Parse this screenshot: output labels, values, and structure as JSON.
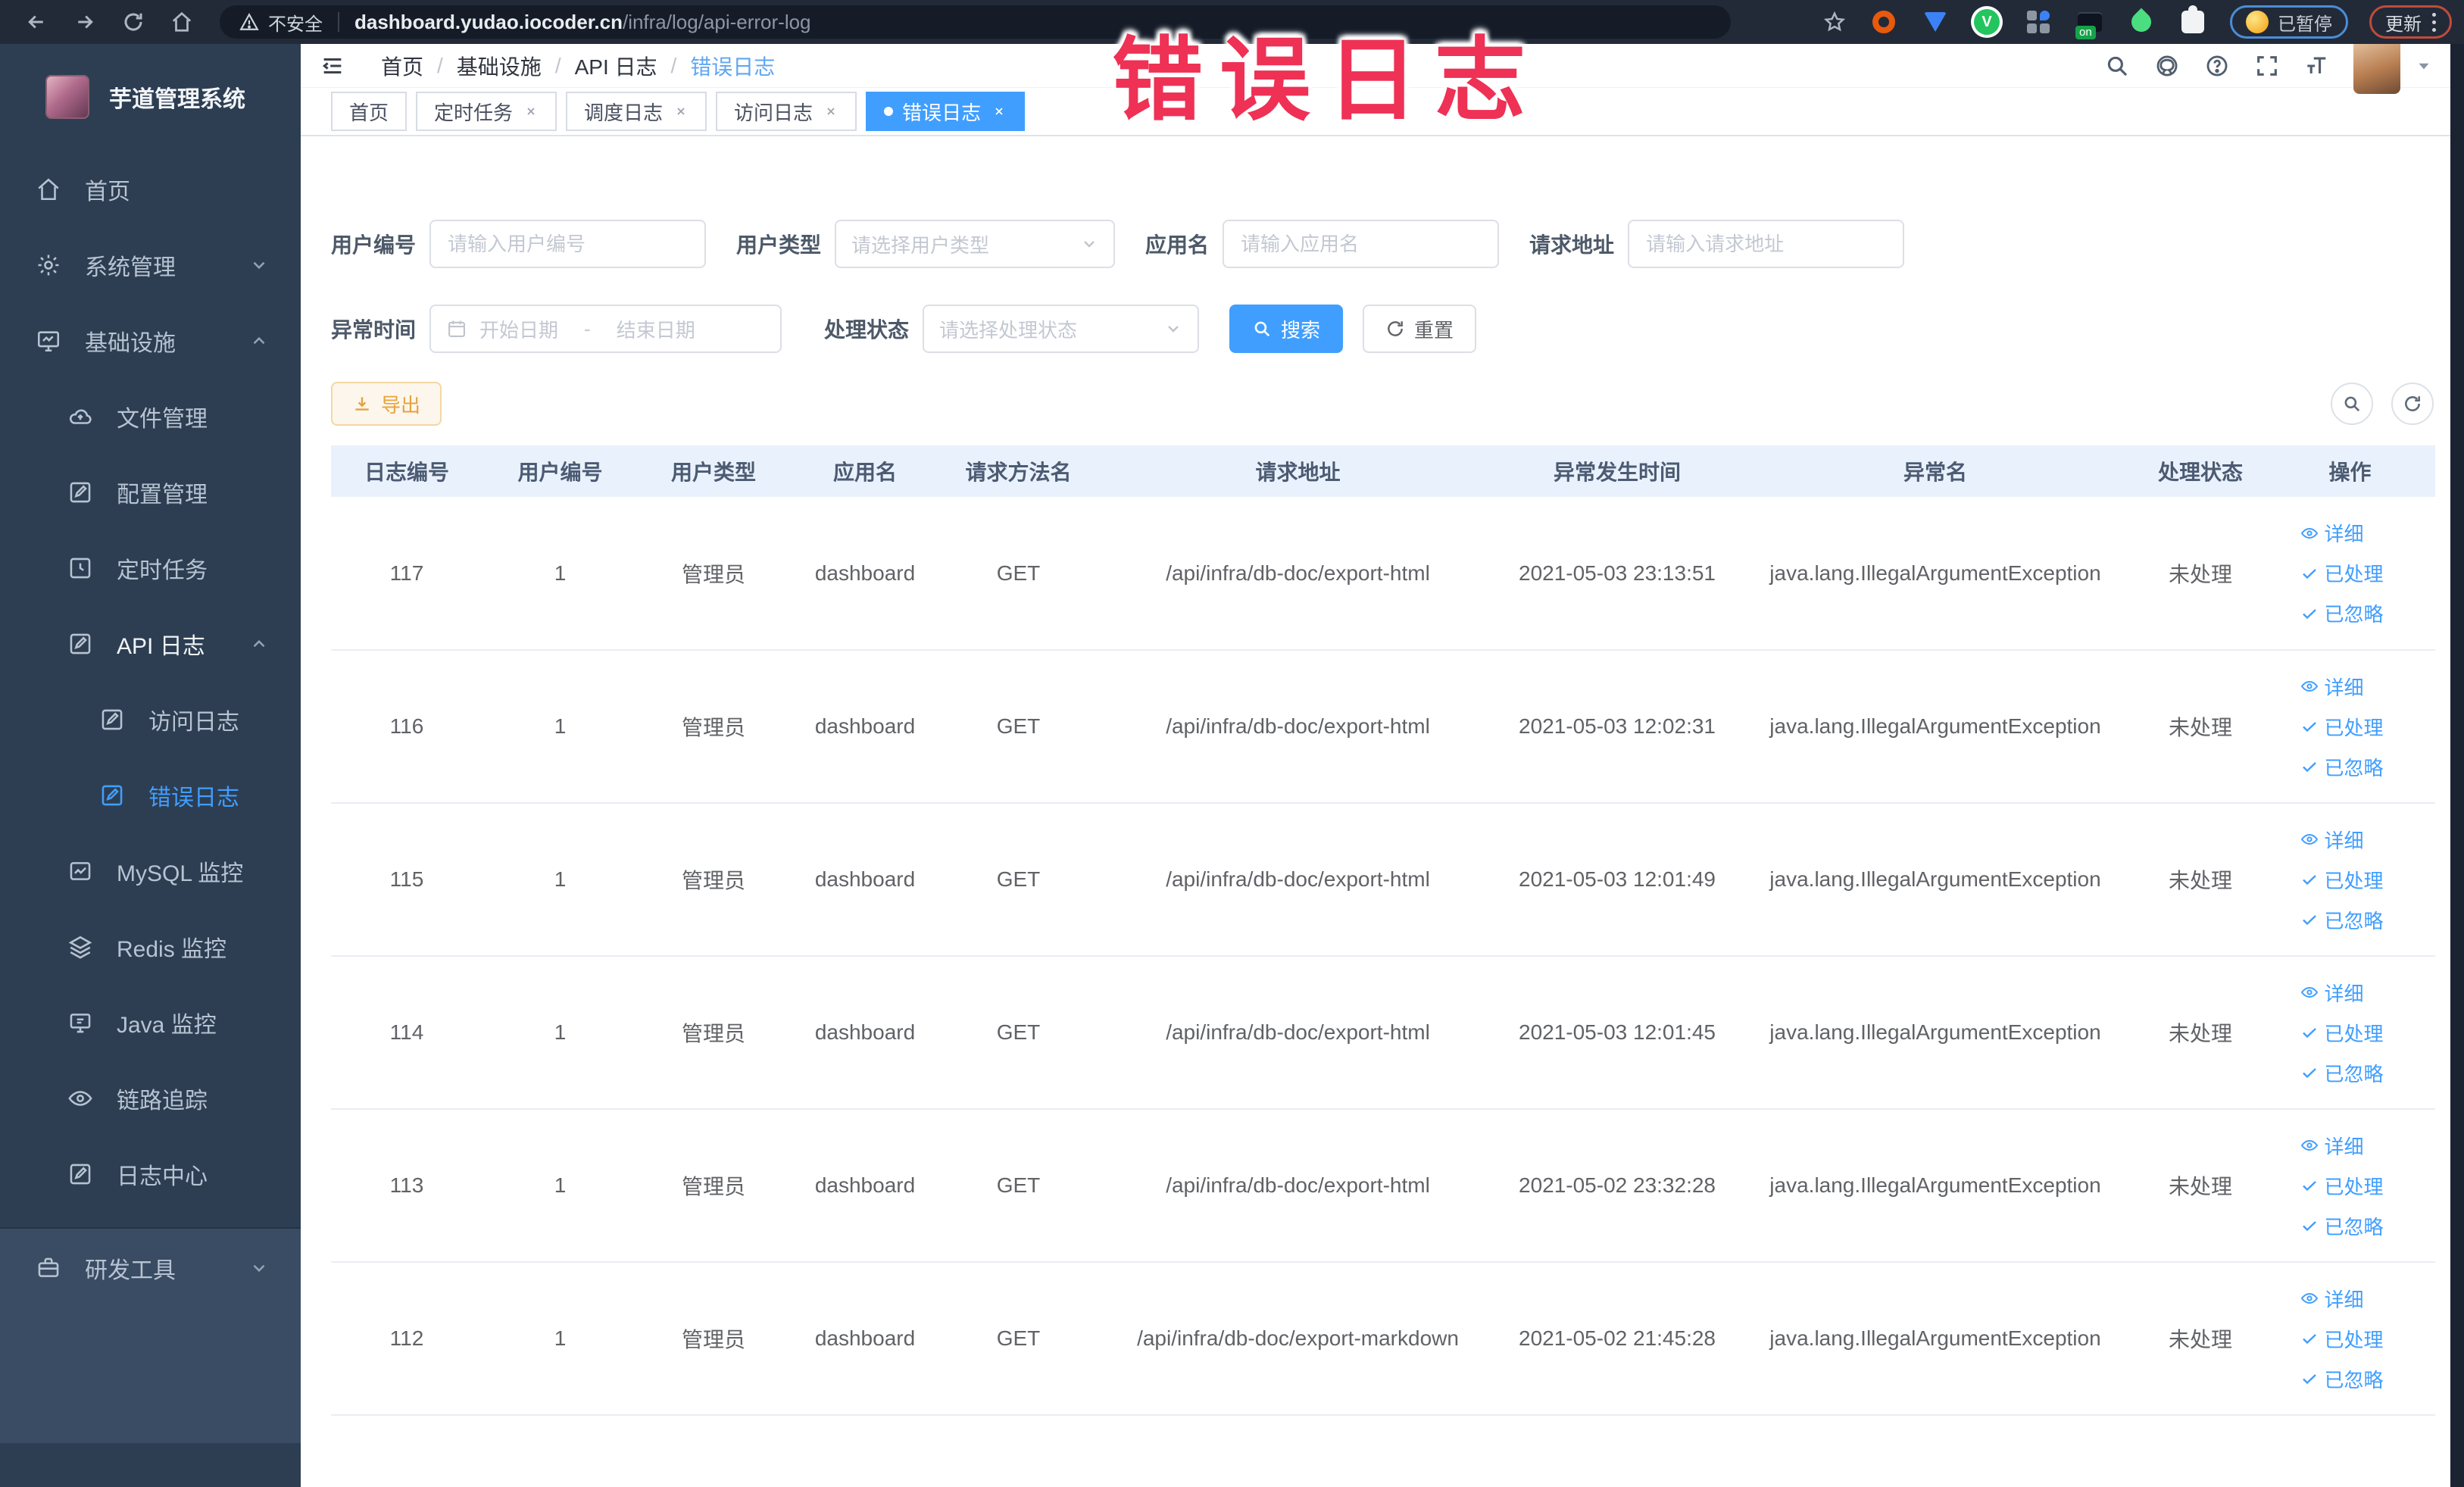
{
  "browser": {
    "security_label": "不安全",
    "url_host": "dashboard.yudao.iocoder.cn",
    "url_path": "/infra/log/api-error-log",
    "extension_badge_on": "on",
    "paused_pill": "已暂停",
    "update_pill": "更新"
  },
  "annotation": {
    "text": "错误日志",
    "color": "#ee3155"
  },
  "app": {
    "title": "芋道管理系统"
  },
  "sidebar": {
    "items": [
      {
        "label": "首页"
      },
      {
        "label": "系统管理"
      },
      {
        "label": "基础设施"
      },
      {
        "label": "文件管理"
      },
      {
        "label": "配置管理"
      },
      {
        "label": "定时任务"
      },
      {
        "label": "API 日志"
      },
      {
        "label": "访问日志"
      },
      {
        "label": "错误日志"
      },
      {
        "label": "MySQL 监控"
      },
      {
        "label": "Redis 监控"
      },
      {
        "label": "Java 监控"
      },
      {
        "label": "链路追踪"
      },
      {
        "label": "日志中心"
      },
      {
        "label": "研发工具"
      }
    ]
  },
  "breadcrumb": {
    "separator": "/",
    "items": [
      "首页",
      "基础设施",
      "API 日志",
      "错误日志"
    ]
  },
  "tabs": [
    {
      "label": "首页"
    },
    {
      "label": "定时任务"
    },
    {
      "label": "调度日志"
    },
    {
      "label": "访问日志"
    },
    {
      "label": "错误日志"
    }
  ],
  "filters": {
    "user_id": {
      "label": "用户编号",
      "placeholder": "请输入用户编号"
    },
    "user_type": {
      "label": "用户类型",
      "placeholder": "请选择用户类型"
    },
    "app_name": {
      "label": "应用名",
      "placeholder": "请输入应用名"
    },
    "request_url": {
      "label": "请求地址",
      "placeholder": "请输入请求地址"
    },
    "exception_time": {
      "label": "异常时间",
      "start_placeholder": "开始日期",
      "separator": "-",
      "end_placeholder": "结束日期"
    },
    "process_status": {
      "label": "处理状态",
      "placeholder": "请选择处理状态"
    },
    "search_button": "搜索",
    "reset_button": "重置"
  },
  "toolbar": {
    "export_button": "导出"
  },
  "table": {
    "headers": [
      "日志编号",
      "用户编号",
      "用户类型",
      "应用名",
      "请求方法名",
      "请求地址",
      "异常发生时间",
      "异常名",
      "处理状态",
      "操作"
    ],
    "actions": {
      "detail": "详细",
      "processed": "已处理",
      "ignored": "已忽略"
    },
    "rows": [
      {
        "id": "117",
        "user_id": "1",
        "user_type": "管理员",
        "app_name": "dashboard",
        "method": "GET",
        "url": "/api/infra/db-doc/export-html",
        "time": "2021-05-03 23:13:51",
        "exception": "java.lang.IllegalArgumentException",
        "status": "未处理"
      },
      {
        "id": "116",
        "user_id": "1",
        "user_type": "管理员",
        "app_name": "dashboard",
        "method": "GET",
        "url": "/api/infra/db-doc/export-html",
        "time": "2021-05-03 12:02:31",
        "exception": "java.lang.IllegalArgumentException",
        "status": "未处理"
      },
      {
        "id": "115",
        "user_id": "1",
        "user_type": "管理员",
        "app_name": "dashboard",
        "method": "GET",
        "url": "/api/infra/db-doc/export-html",
        "time": "2021-05-03 12:01:49",
        "exception": "java.lang.IllegalArgumentException",
        "status": "未处理"
      },
      {
        "id": "114",
        "user_id": "1",
        "user_type": "管理员",
        "app_name": "dashboard",
        "method": "GET",
        "url": "/api/infra/db-doc/export-html",
        "time": "2021-05-03 12:01:45",
        "exception": "java.lang.IllegalArgumentException",
        "status": "未处理"
      },
      {
        "id": "113",
        "user_id": "1",
        "user_type": "管理员",
        "app_name": "dashboard",
        "method": "GET",
        "url": "/api/infra/db-doc/export-html",
        "time": "2021-05-02 23:32:28",
        "exception": "java.lang.IllegalArgumentException",
        "status": "未处理"
      },
      {
        "id": "112",
        "user_id": "1",
        "user_type": "管理员",
        "app_name": "dashboard",
        "method": "GET",
        "url": "/api/infra/db-doc/export-markdown",
        "time": "2021-05-02 21:45:28",
        "exception": "java.lang.IllegalArgumentException",
        "status": "未处理"
      }
    ]
  },
  "colors": {
    "accent": "#409eff",
    "warning": "#e6a23c",
    "sidebar_bg": "#2d3e52",
    "annotation": "#ee3155"
  }
}
